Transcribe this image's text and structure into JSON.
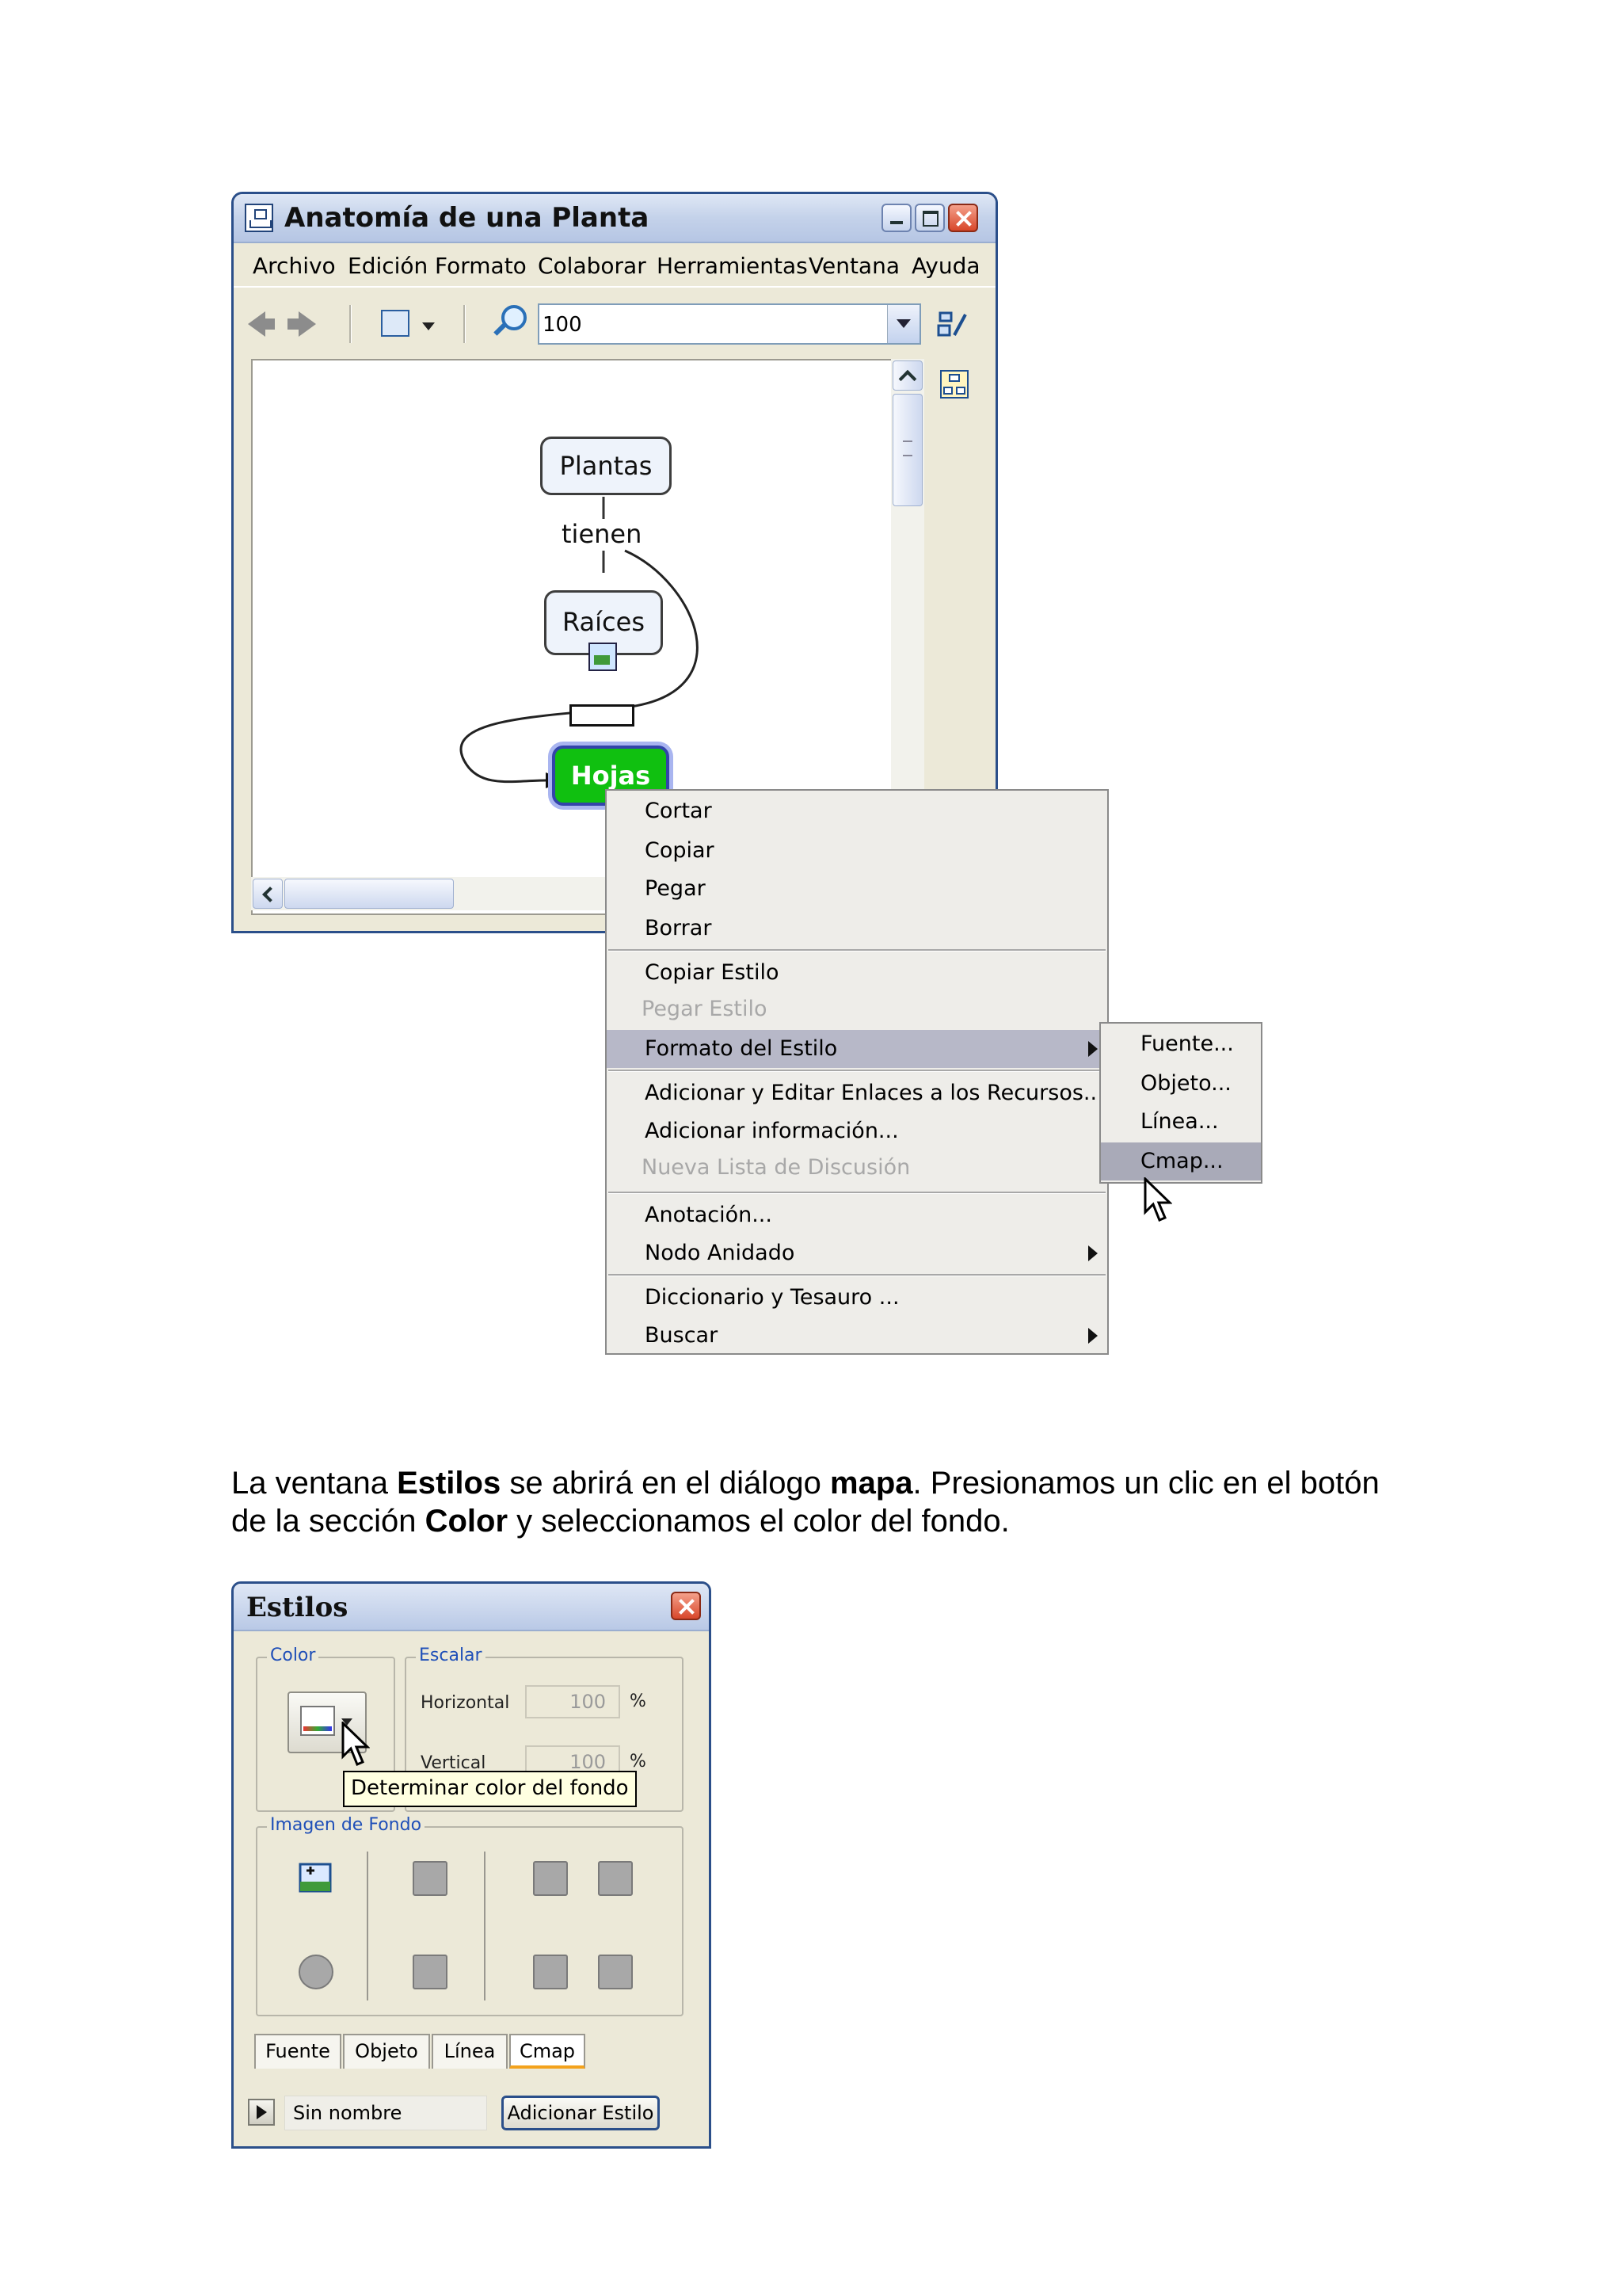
{
  "cmap_window": {
    "title": "Anatomía de una Planta",
    "menu": [
      "Archivo",
      "Edición",
      "Formato",
      "Colaborar",
      "Herramientas",
      "Ventana",
      "Ayuda"
    ],
    "zoom_value": "100",
    "concept_map": {
      "nodes": {
        "plantas": "Plantas",
        "raices": "Raíces",
        "hojas": "Hojas"
      },
      "link_label": "tienen"
    }
  },
  "context_menu": {
    "items": {
      "cortar": "Cortar",
      "copiar": "Copiar",
      "pegar": "Pegar",
      "borrar": "Borrar",
      "copiar_estilo": "Copiar Estilo",
      "pegar_estilo": "Pegar Estilo",
      "formato_estilo": "Formato del Estilo",
      "adicionar_enlaces": "Adicionar y Editar Enlaces a los Recursos...",
      "adicionar_info": "Adicionar información...",
      "nueva_lista": "Nueva Lista de Discusión",
      "anotacion": "Anotación...",
      "nodo_anidado": "Nodo Anidado",
      "diccionario": "Diccionario y Tesauro ...",
      "buscar": "Buscar"
    },
    "submenu": {
      "fuente": "Fuente...",
      "objeto": "Objeto...",
      "linea": "Línea...",
      "cmap": "Cmap..."
    }
  },
  "paragraph": {
    "p1": "La ventana ",
    "b1": "Estilos",
    "p2": " se abrirá en el diálogo ",
    "b2": "mapa",
    "p3": ". Presionamos un clic en el botón de la sección ",
    "b3": "Color",
    "p4": "  y seleccionamos el color del fondo."
  },
  "estilos_window": {
    "title": "Estilos",
    "color_group": "Color",
    "escalar_group": "Escalar",
    "horizontal_label": "Horizontal",
    "vertical_label": "Vertical",
    "horizontal_value": "100",
    "vertical_value": "100",
    "percent": "%",
    "tooltip": "Determinar color del fondo",
    "imagen_group": "Imagen de Fondo",
    "tabs": {
      "fuente": "Fuente",
      "objeto": "Objeto",
      "linea": "Línea",
      "cmap": "Cmap"
    },
    "style_name": "Sin nombre",
    "add_style_button": "Adicionar Estilo"
  }
}
